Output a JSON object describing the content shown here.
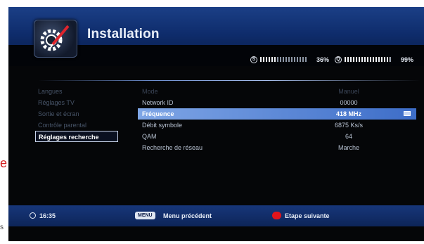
{
  "header": {
    "title": "Installation",
    "signal": {
      "strength_label": "36%",
      "strength_value": 0.36,
      "quality_label": "99%",
      "quality_value": 0.99
    }
  },
  "sidebar": {
    "items": [
      {
        "label": "Langues"
      },
      {
        "label": "Réglages TV"
      },
      {
        "label": "Sortie et écran"
      },
      {
        "label": "Contrôle parental"
      },
      {
        "label": "Réglages recherche"
      }
    ],
    "active_index": 4
  },
  "table": {
    "rows": [
      {
        "label": "Mode",
        "value": "Manuel",
        "dim": true
      },
      {
        "label": "Network ID",
        "value": "00000"
      },
      {
        "label": "Fréquence",
        "value": "418 MHz",
        "selected": true
      },
      {
        "label": "Débit symbole",
        "value": "6875 Ks/s"
      },
      {
        "label": "QAM",
        "value": "64"
      },
      {
        "label": "Recherche de réseau",
        "value": "Marche"
      }
    ]
  },
  "footer": {
    "time": "16:35",
    "menu_key": "MENU",
    "menu_label": "Menu précédent",
    "next_label": "Etape suivante"
  },
  "edge_text": {
    "red": "e",
    "bottom": "s"
  },
  "colors": {
    "accent": "#3d6dc8",
    "header": "#1b3f86",
    "red_key": "#e1141b"
  }
}
